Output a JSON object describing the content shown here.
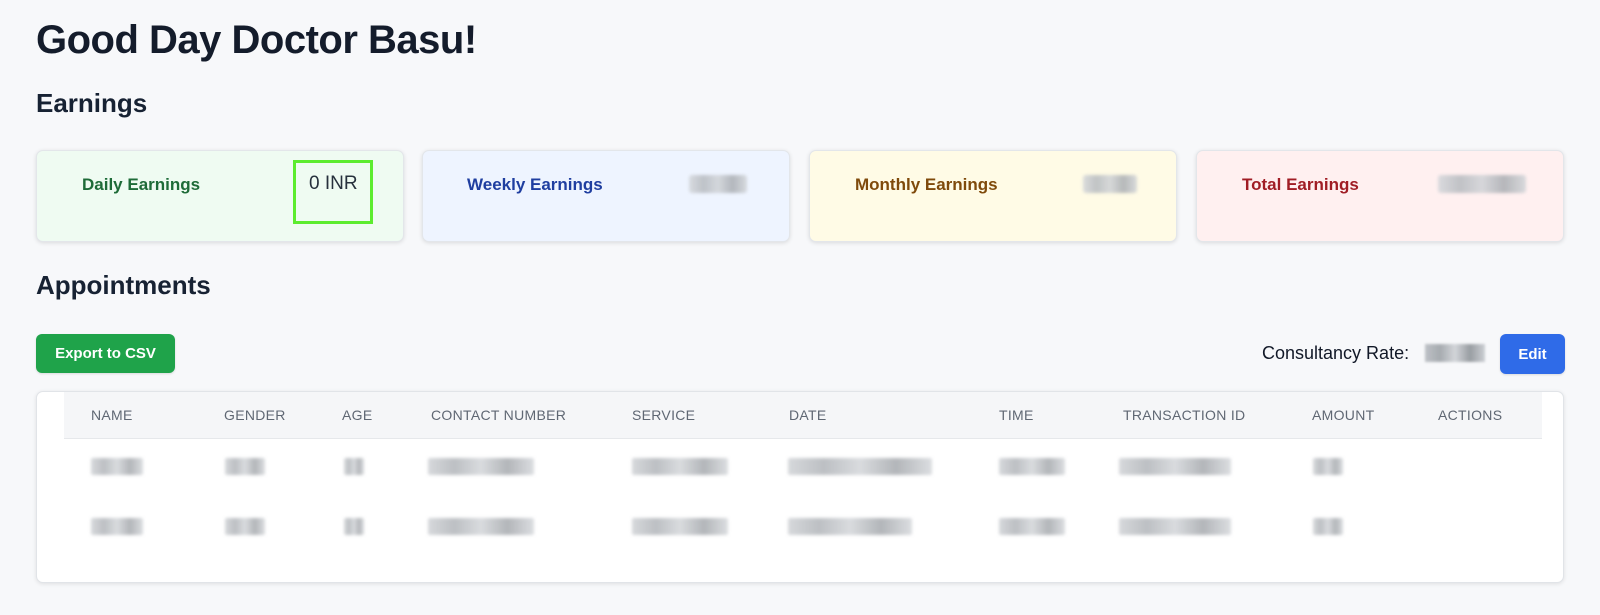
{
  "greeting": "Good Day Doctor Basu!",
  "earnings": {
    "title": "Earnings",
    "cards": [
      {
        "label": "Daily Earnings",
        "value": "0 INR"
      },
      {
        "label": "Weekly Earnings"
      },
      {
        "label": "Monthly Earnings"
      },
      {
        "label": "Total Earnings"
      }
    ]
  },
  "appointments": {
    "title": "Appointments",
    "export_label": "Export to CSV",
    "consultancy_rate_label": "Consultancy Rate:",
    "edit_label": "Edit",
    "table": {
      "headers": [
        "NAME",
        "GENDER",
        "AGE",
        "CONTACT NUMBER",
        "SERVICE",
        "DATE",
        "TIME",
        "TRANSACTION ID",
        "AMOUNT",
        "ACTIONS"
      ]
    }
  },
  "colors": {
    "export_button": "#1fa34a",
    "edit_button": "#2f6be8",
    "highlight_box": "#5cec2f",
    "daily_card": "#effbf2",
    "weekly_card": "#eef4ff",
    "monthly_card": "#fffbe6",
    "total_card": "#fff0f0"
  }
}
